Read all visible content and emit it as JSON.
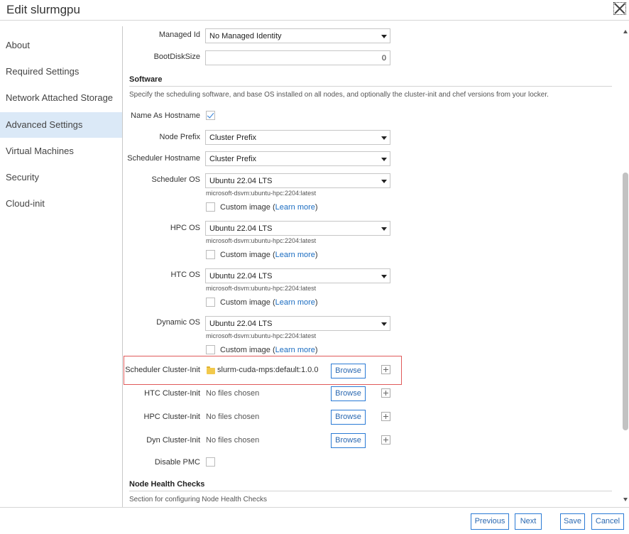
{
  "header": {
    "title": "Edit slurmgpu"
  },
  "nav": {
    "items": [
      {
        "label": "About"
      },
      {
        "label": "Required Settings"
      },
      {
        "label": "Network Attached Storage"
      },
      {
        "label": "Advanced Settings",
        "active": true
      },
      {
        "label": "Virtual Machines"
      },
      {
        "label": "Security"
      },
      {
        "label": "Cloud-init"
      }
    ]
  },
  "fields": {
    "managed_id": {
      "label": "Managed Id",
      "value": "No Managed Identity"
    },
    "boot_disk_size": {
      "label": "BootDiskSize",
      "value": "0"
    }
  },
  "software": {
    "title": "Software",
    "description": "Specify the scheduling software, and base OS installed on all nodes, and optionally the cluster-init and chef versions from your locker.",
    "name_as_hostname": {
      "label": "Name As Hostname",
      "checked": true
    },
    "node_prefix": {
      "label": "Node Prefix",
      "value": "Cluster Prefix"
    },
    "scheduler_hostname": {
      "label": "Scheduler Hostname",
      "value": "Cluster Prefix"
    },
    "scheduler_os": {
      "label": "Scheduler OS",
      "value": "Ubuntu 22.04 LTS",
      "hint": "microsoft-dsvm:ubuntu-hpc:2204:latest",
      "custom_label": "Custom image",
      "learn_more": "Learn more"
    },
    "hpc_os": {
      "label": "HPC OS",
      "value": "Ubuntu 22.04 LTS",
      "hint": "microsoft-dsvm:ubuntu-hpc:2204:latest",
      "custom_label": "Custom image",
      "learn_more": "Learn more"
    },
    "htc_os": {
      "label": "HTC OS",
      "value": "Ubuntu 22.04 LTS",
      "hint": "microsoft-dsvm:ubuntu-hpc:2204:latest",
      "custom_label": "Custom image",
      "learn_more": "Learn more"
    },
    "dynamic_os": {
      "label": "Dynamic OS",
      "value": "Ubuntu 22.04 LTS",
      "hint": "microsoft-dsvm:ubuntu-hpc:2204:latest",
      "custom_label": "Custom image",
      "learn_more": "Learn more"
    },
    "scheduler_cluster_init": {
      "label": "Scheduler Cluster-Init",
      "value": "slurm-cuda-mps:default:1.0.0",
      "browse": "Browse"
    },
    "htc_cluster_init": {
      "label": "HTC Cluster-Init",
      "value": "No files chosen",
      "browse": "Browse"
    },
    "hpc_cluster_init": {
      "label": "HPC Cluster-Init",
      "value": "No files chosen",
      "browse": "Browse"
    },
    "dyn_cluster_init": {
      "label": "Dyn Cluster-Init",
      "value": "No files chosen",
      "browse": "Browse"
    },
    "disable_pmc": {
      "label": "Disable PMC",
      "checked": false
    }
  },
  "node_health": {
    "title": "Node Health Checks",
    "description": "Section for configuring Node Health Checks"
  },
  "footer": {
    "previous": "Previous",
    "next": "Next",
    "save": "Save",
    "cancel": "Cancel"
  }
}
